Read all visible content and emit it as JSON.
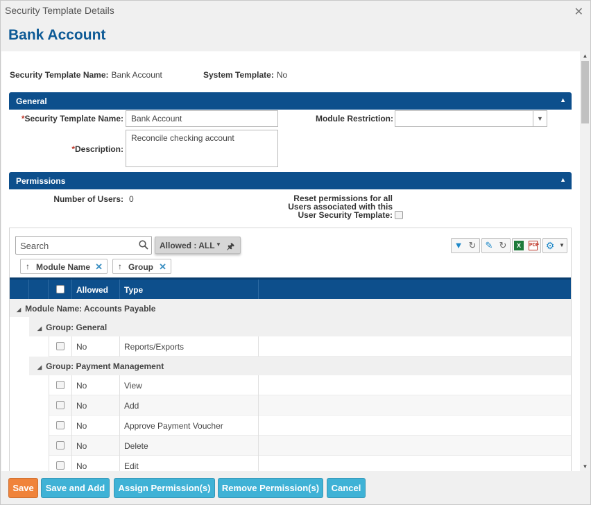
{
  "window": {
    "title": "Security Template Details"
  },
  "page": {
    "heading": "Bank Account"
  },
  "summary": {
    "template_name_label": "Security Template Name:",
    "template_name_value": "Bank Account",
    "system_template_label": "System Template:",
    "system_template_value": "No"
  },
  "general": {
    "title": "General",
    "name_required": "*",
    "name_label": "Security Template Name:",
    "name_value": "Bank Account",
    "module_restriction_label": "Module Restriction:",
    "module_restriction_value": "",
    "description_required": "*",
    "description_label": "Description:",
    "description_value": "Reconcile checking account"
  },
  "permissions": {
    "title": "Permissions",
    "users_label": "Number of Users:",
    "users_value": "0",
    "reset_label_1": "Reset permissions for all",
    "reset_label_2": "Users associated with this",
    "reset_label_3": "User Security Template:",
    "reset_checked": false
  },
  "grid": {
    "search_placeholder": "Search",
    "filter_label": "Allowed : ALL",
    "group_chips": [
      {
        "label": "Module Name"
      },
      {
        "label": "Group"
      }
    ],
    "columns": {
      "allowed": "Allowed",
      "type": "Type"
    },
    "module_group": "Module Name: Accounts Payable",
    "group_general": "Group: General",
    "group_payment": "Group: Payment Management",
    "rows_general": [
      {
        "allowed": "No",
        "type": "Reports/Exports"
      }
    ],
    "rows_payment": [
      {
        "allowed": "No",
        "type": "View"
      },
      {
        "allowed": "No",
        "type": "Add"
      },
      {
        "allowed": "No",
        "type": "Approve Payment Voucher"
      },
      {
        "allowed": "No",
        "type": "Delete"
      },
      {
        "allowed": "No",
        "type": "Edit"
      }
    ]
  },
  "footer": {
    "save": "Save",
    "save_and_add": "Save and Add",
    "assign": "Assign Permission(s)",
    "remove": "Remove Permission(s)",
    "cancel": "Cancel"
  },
  "colors": {
    "header_blue": "#0d4f8c",
    "heading_blue": "#0d5a96",
    "save_orange": "#f0833a",
    "action_teal": "#3fb2d6"
  }
}
